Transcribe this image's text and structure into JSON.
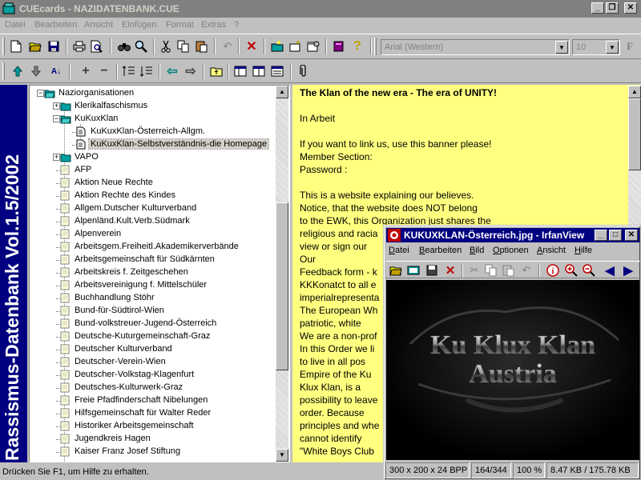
{
  "app": {
    "title": "CUEcards - NAZIDATENBANK.CUE",
    "caption_buttons": [
      "_",
      "❐",
      "✕"
    ]
  },
  "menu": [
    "Datei",
    "Bearbeiten",
    "Ansicht",
    "Einfügen",
    "Format",
    "Extras",
    "?"
  ],
  "font_combo": {
    "value": "Arial (Western)"
  },
  "size_combo": {
    "value": "10"
  },
  "format_button": "F",
  "banner": {
    "text": "Rassismus-Datenbank Vol.1.5/2002",
    "color": "#000080"
  },
  "tree": {
    "items": [
      {
        "label": "Naziorganisationen",
        "level": 1,
        "expander": "−",
        "icon": "open-folder-icon",
        "lines": false
      },
      {
        "label": "Klerikalfaschismus",
        "level": 2,
        "expander": "+",
        "icon": "closed-book-icon"
      },
      {
        "label": "KuKuxKlan",
        "level": 2,
        "expander": "−",
        "icon": "open-book-icon"
      },
      {
        "label": "KuKuxKlan-Österreich-Allgm.",
        "level": 3,
        "icon": "document-icon"
      },
      {
        "label": "KuKuxKlan-Selbstverständnis-die Homepage",
        "level": 3,
        "icon": "document-icon",
        "selected": true
      },
      {
        "label": "VAPO",
        "level": 2,
        "expander": "+",
        "icon": "closed-book-icon"
      },
      {
        "label": "AFP",
        "level": 2,
        "icon": "card-icon"
      },
      {
        "label": "Aktion Neue Rechte",
        "level": 2,
        "icon": "card-icon"
      },
      {
        "label": "Aktion Rechte des Kindes",
        "level": 2,
        "icon": "card-icon"
      },
      {
        "label": "Allgem.Dutscher Kulturverband",
        "level": 2,
        "icon": "card-icon"
      },
      {
        "label": "Alpenländ.Kult.Verb.Südmark",
        "level": 2,
        "icon": "card-icon"
      },
      {
        "label": "Alpenverein",
        "level": 2,
        "icon": "card-icon"
      },
      {
        "label": "Arbeitsgem.Freiheitl.Akademikerverbände",
        "level": 2,
        "icon": "card-icon"
      },
      {
        "label": "Arbeitsgemeinschaft für Südkärnten",
        "level": 2,
        "icon": "card-icon"
      },
      {
        "label": "Arbeitskreis f. Zeitgeschehen",
        "level": 2,
        "icon": "card-icon"
      },
      {
        "label": "Arbeitsvereinigung f. Mittelschüler",
        "level": 2,
        "icon": "card-icon"
      },
      {
        "label": "Buchhandlung Stöhr",
        "level": 2,
        "icon": "card-icon"
      },
      {
        "label": "Bund-für-Südtirol-Wien",
        "level": 2,
        "icon": "card-icon"
      },
      {
        "label": "Bund-volkstreuer-Jugend-Österreich",
        "level": 2,
        "icon": "card-icon"
      },
      {
        "label": "Deutsche-Kuturgemeinschaft-Graz",
        "level": 2,
        "icon": "card-icon"
      },
      {
        "label": "Deutscher Kulturverband",
        "level": 2,
        "icon": "card-icon"
      },
      {
        "label": "Deutscher-Verein-Wien",
        "level": 2,
        "icon": "card-icon"
      },
      {
        "label": "Deutscher-Volkstag-Klagenfurt",
        "level": 2,
        "icon": "card-icon"
      },
      {
        "label": "Deutsches-Kulturwerk-Graz",
        "level": 2,
        "icon": "card-icon"
      },
      {
        "label": "Freie Pfadfinderschaft Nibelungen",
        "level": 2,
        "icon": "card-icon"
      },
      {
        "label": "Hilfsgemeinschaft für Walter Reder",
        "level": 2,
        "icon": "card-icon"
      },
      {
        "label": "Historiker Arbeitsgemeinschaft",
        "level": 2,
        "icon": "card-icon"
      },
      {
        "label": "Jugendkreis Hagen",
        "level": 2,
        "icon": "card-icon"
      },
      {
        "label": "Kaiser Franz Josef Stiftung",
        "level": 2,
        "icon": "card-icon"
      }
    ]
  },
  "text_pane": {
    "background": "#ffff80",
    "lines": [
      {
        "text": "The Klan of the new era - The era of UNITY!",
        "bold": true
      },
      {
        "text": "",
        "bold": false
      },
      {
        "text": " In Arbeit",
        "bold": false
      },
      {
        "text": "",
        "bold": false
      },
      {
        "text": "If you want to link us, use this banner please!",
        "bold": false
      },
      {
        "text": "Member Section:",
        "bold": false
      },
      {
        "text": "Password :",
        "bold": false
      },
      {
        "text": "",
        "bold": false
      },
      {
        "text": "This is a website explaining our believes.",
        "bold": false
      },
      {
        "text": "Notice, that the website does NOT belong",
        "bold": false
      },
      {
        "text": "to the EWK, this Organization just shares the",
        "bold": false
      },
      {
        "text": "religious and racia",
        "bold": false
      },
      {
        "text": "view or sign our",
        "bold": false
      },
      {
        "text": "Our",
        "bold": false
      },
      {
        "text": "Feedback form - k",
        "bold": false
      },
      {
        "text": "KKKonatct to all e",
        "bold": false
      },
      {
        "text": "imperialrepresenta",
        "bold": false
      },
      {
        "text": "The European Wh",
        "bold": false
      },
      {
        "text": "    patriotic, white",
        "bold": false
      },
      {
        "text": "We are a non-prof",
        "bold": false
      },
      {
        "text": "In this Order we li",
        "bold": false
      },
      {
        "text": "    to live in all pos",
        "bold": false
      },
      {
        "text": "Empire of the Ku",
        "bold": false
      },
      {
        "text": "    Klux Klan, is a",
        "bold": false
      },
      {
        "text": "possibility to leave",
        "bold": false
      },
      {
        "text": "    order. Because",
        "bold": false
      },
      {
        "text": "principles and whe",
        "bold": false
      },
      {
        "text": "    cannot identify",
        "bold": false
      },
      {
        "text": "\"White Boys Club",
        "bold": false
      }
    ]
  },
  "status_bar": {
    "text": "Drücken Sie F1, um Hilfe zu erhalten."
  },
  "irfanview": {
    "title": "KUKUXKLAN-Österreich.jpg - IrfanView",
    "menu": [
      {
        "first": "D",
        "rest": "atei"
      },
      {
        "first": "B",
        "rest": "earbeiten"
      },
      {
        "first": "B",
        "rest": "ild"
      },
      {
        "first": "O",
        "rest": "ptionen"
      },
      {
        "first": "A",
        "rest": "nsicht"
      },
      {
        "first": "H",
        "rest": "ilfe"
      }
    ],
    "image": {
      "line1": "Ku Klux Klan",
      "line2": "Austria"
    },
    "status": [
      "300 x 200 x 24 BPP",
      "164/344",
      "100 %",
      "8.47 KB / 175.78 KB"
    ]
  }
}
